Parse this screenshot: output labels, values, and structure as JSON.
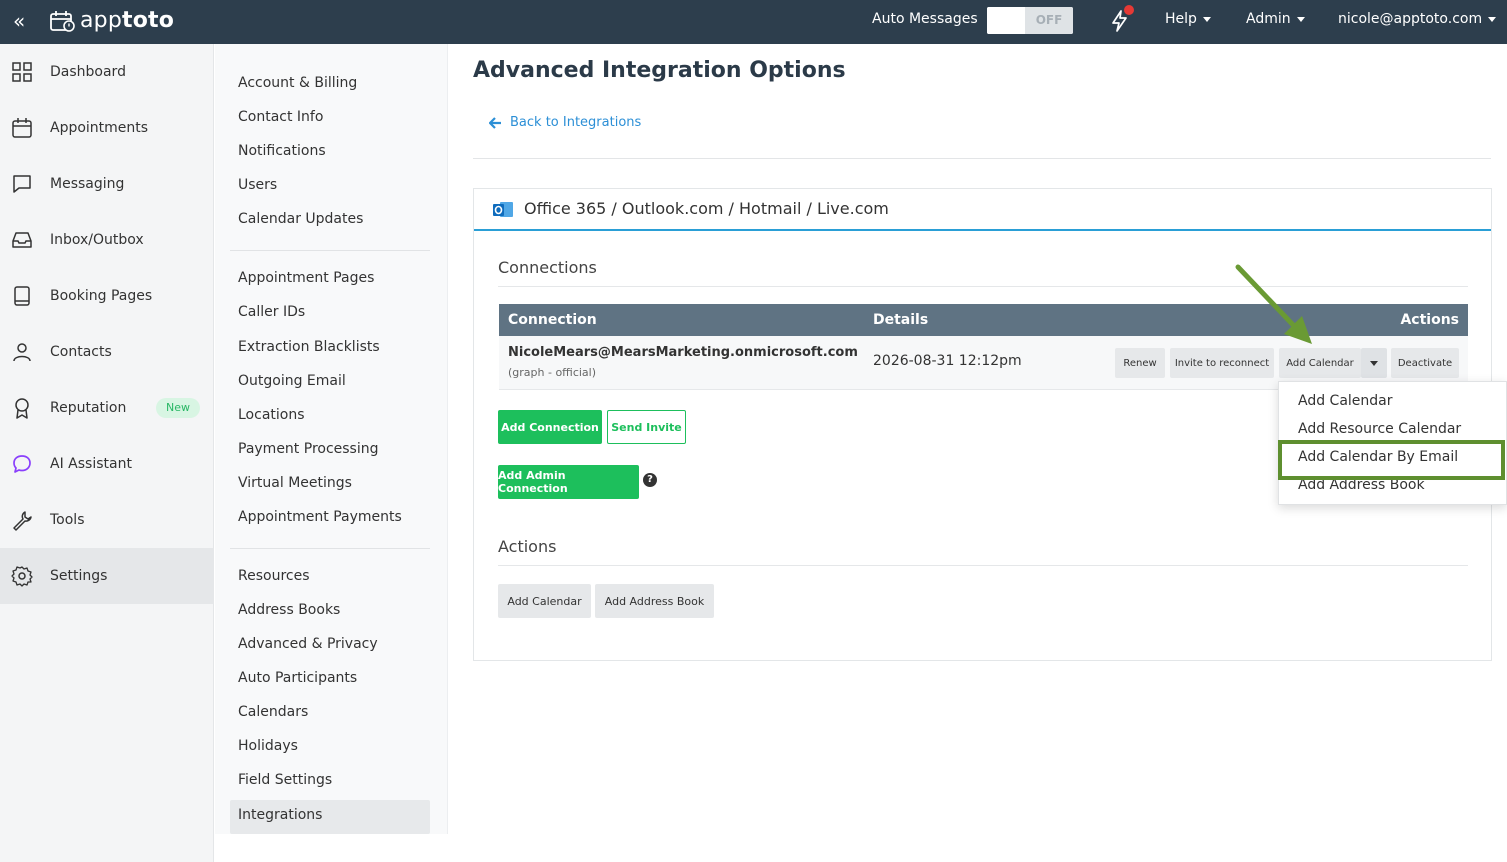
{
  "topbar": {
    "collapse_glyph": "«",
    "logo_text_light": "app",
    "logo_text_bold": "toto",
    "auto_messages_label": "Auto Messages",
    "toggle_state": "OFF",
    "help_label": "Help",
    "admin_label": "Admin",
    "user_email": "nicole@apptoto.com",
    "notification_dot_color": "#e53935"
  },
  "sidebar": {
    "items": [
      {
        "label": "Dashboard",
        "icon": "grid-icon"
      },
      {
        "label": "Appointments",
        "icon": "calendar-icon"
      },
      {
        "label": "Messaging",
        "icon": "chat-icon"
      },
      {
        "label": "Inbox/Outbox",
        "icon": "inbox-icon"
      },
      {
        "label": "Booking Pages",
        "icon": "book-icon"
      },
      {
        "label": "Contacts",
        "icon": "person-icon"
      },
      {
        "label": "Reputation",
        "icon": "award-icon",
        "badge": "New"
      },
      {
        "label": "AI Assistant",
        "icon": "ai-chat-icon"
      },
      {
        "label": "Tools",
        "icon": "wrench-icon"
      },
      {
        "label": "Settings",
        "icon": "gear-icon",
        "active": true
      }
    ]
  },
  "settings_menu": {
    "group1": [
      "Account & Billing",
      "Contact Info",
      "Notifications",
      "Users",
      "Calendar Updates"
    ],
    "group2": [
      "Appointment Pages",
      "Caller IDs",
      "Extraction Blacklists",
      "Outgoing Email",
      "Locations",
      "Payment Processing",
      "Virtual Meetings",
      "Appointment Payments"
    ],
    "group3": [
      "Resources",
      "Address Books",
      "Advanced & Privacy",
      "Auto Participants",
      "Calendars",
      "Holidays",
      "Field Settings",
      "Integrations"
    ]
  },
  "main": {
    "title": "Advanced Integration Options",
    "back_link": "Back to Integrations",
    "card_title": "Office 365 / Outlook.com / Hotmail / Live.com",
    "connections_title": "Connections",
    "table": {
      "headers": {
        "connection": "Connection",
        "details": "Details",
        "actions": "Actions"
      },
      "row": {
        "email": "NicoleMears@MearsMarketing.onmicrosoft.com",
        "sub": "(graph - official)",
        "details": "2026-08-31 12:12pm",
        "buttons": {
          "renew": "Renew",
          "invite": "Invite to reconnect",
          "add_calendar": "Add Calendar",
          "deactivate": "Deactivate"
        }
      }
    },
    "buttons": {
      "add_connection": "Add Connection",
      "send_invite": "Send Invite",
      "add_admin_connection": "Add Admin Connection",
      "help": "?"
    },
    "actions_title": "Actions",
    "action_buttons": {
      "add_calendar": "Add Calendar",
      "add_address_book": "Add Address Book"
    }
  },
  "dropdown": {
    "items": [
      "Add Calendar",
      "Add Resource Calendar",
      "Add Calendar By Email",
      "Add Address Book"
    ],
    "highlighted": "Add Calendar By Email",
    "highlight_color": "#5e8f2f"
  },
  "colors": {
    "topbar": "#2d3e4d",
    "green": "#1dbf5c",
    "link": "#2c8fd6",
    "table_header": "#5f7383"
  }
}
